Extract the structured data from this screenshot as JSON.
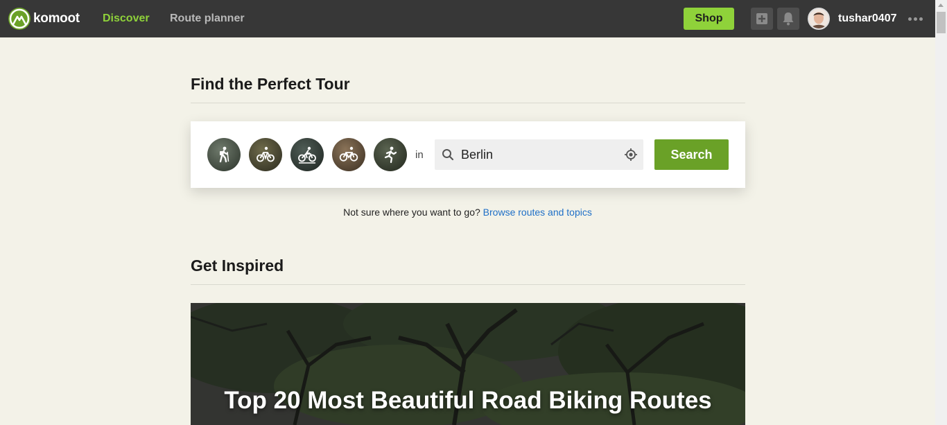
{
  "nav": {
    "brand": "komoot",
    "discover": "Discover",
    "route_planner": "Route planner",
    "shop": "Shop",
    "username": "tushar0407"
  },
  "finder": {
    "title": "Find the Perfect Tour",
    "sports": [
      "hiking",
      "touring-bike",
      "mountain-bike",
      "road-bike",
      "running"
    ],
    "in_label": "in",
    "location_value": "Berlin",
    "search_label": "Search",
    "browse_prompt": "Not sure where you want to go?",
    "browse_link": "Browse routes and topics"
  },
  "inspired": {
    "title": "Get Inspired",
    "hero_title": "Top 20 Most Beautiful Road Biking Routes"
  },
  "colors": {
    "nav_bg": "#373737",
    "accent_green": "#8fd23a",
    "button_green": "#6aa127",
    "link_blue": "#1e6fc7",
    "page_bg": "#f3f2e8"
  }
}
